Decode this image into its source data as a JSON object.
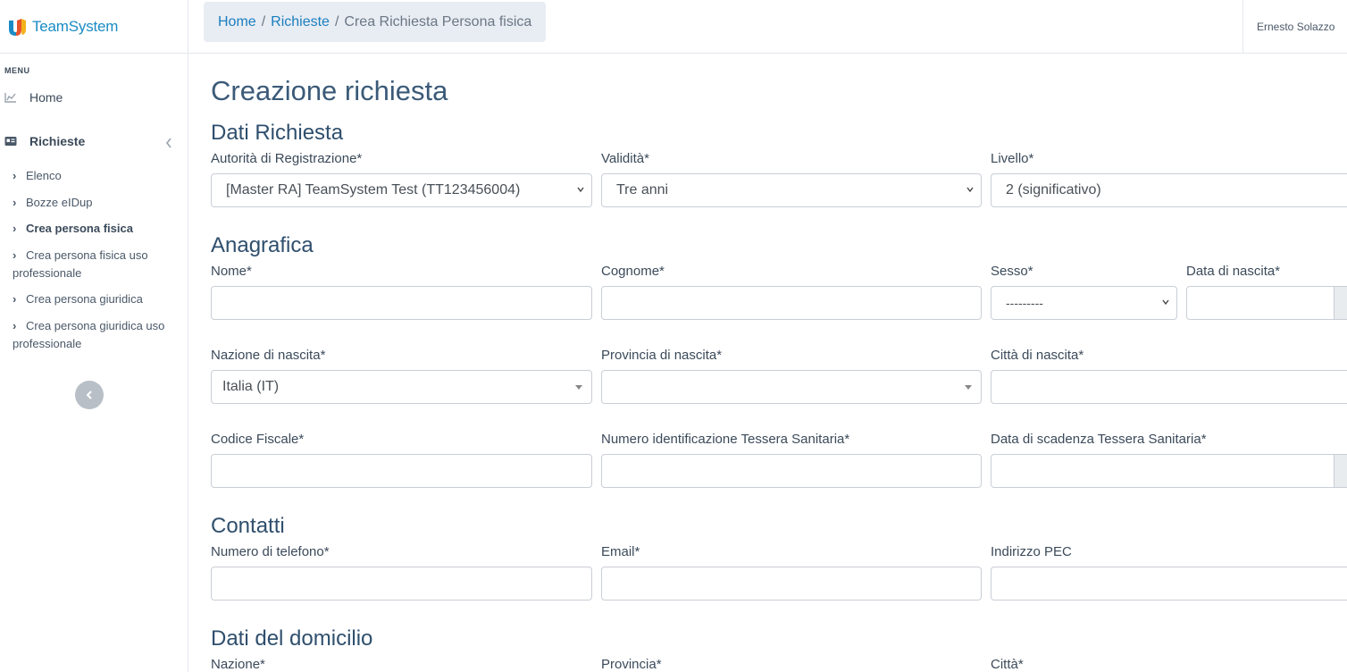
{
  "brand": {
    "name": "TeamSystem"
  },
  "sidebar": {
    "menu_label": "MENU",
    "home": "Home",
    "richieste": "Richieste",
    "sub_items": [
      "Elenco",
      "Bozze eIDup",
      "Crea persona fisica",
      "Crea persona fisica uso professionale",
      "Crea persona giuridica",
      "Crea persona giuridica uso professionale"
    ]
  },
  "breadcrumb": {
    "home": "Home",
    "richieste": "Richieste",
    "current": "Crea Richiesta Persona fisica"
  },
  "user": {
    "name": "Ernesto Solazzo"
  },
  "page": {
    "title": "Creazione richiesta"
  },
  "dati_richiesta": {
    "title": "Dati Richiesta",
    "autorita_label": "Autorità di Registrazione*",
    "autorita_value": "[Master RA] TeamSystem Test (TT123456004)",
    "validita_label": "Validità*",
    "validita_value": "Tre anni",
    "livello_label": "Livello*",
    "livello_value": "2 (significativo)"
  },
  "anagrafica": {
    "title": "Anagrafica",
    "nome_label": "Nome*",
    "cognome_label": "Cognome*",
    "sesso_label": "Sesso*",
    "sesso_value": "---------",
    "data_nascita_label": "Data di nascita*",
    "nazione_nascita_label": "Nazione di nascita*",
    "nazione_nascita_value": "Italia (IT)",
    "provincia_nascita_label": "Provincia di nascita*",
    "citta_nascita_label": "Città di nascita*",
    "codice_fiscale_label": "Codice Fiscale*",
    "tessera_num_label": "Numero identificazione Tessera Sanitaria*",
    "tessera_scad_label": "Data di scadenza Tessera Sanitaria*"
  },
  "contatti": {
    "title": "Contatti",
    "telefono_label": "Numero di telefono*",
    "email_label": "Email*",
    "pec_label": "Indirizzo PEC"
  },
  "domicilio": {
    "title": "Dati del domicilio",
    "nazione_label": "Nazione*",
    "provincia_label": "Provincia*",
    "citta_label": "Città*"
  },
  "colors": {
    "accent": "#1a7fbf",
    "heading": "#2f4f6d",
    "border": "#c9ced6"
  }
}
